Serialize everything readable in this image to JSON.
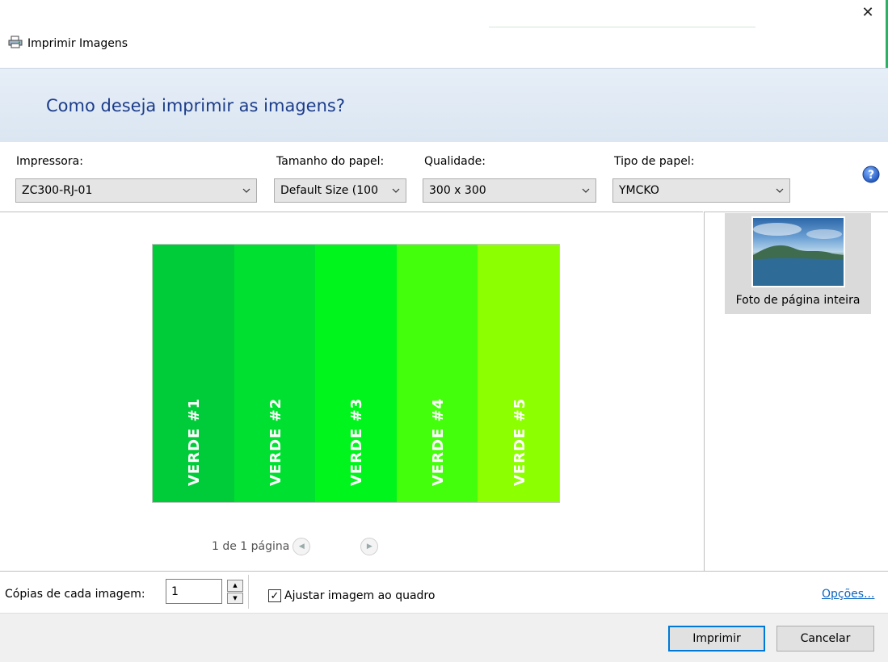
{
  "window": {
    "title": "Imprimir Imagens",
    "close_glyph": "✕",
    "icons": [
      "printer-icon",
      "close-icon"
    ]
  },
  "header": {
    "question": "Como deseja imprimir as imagens?"
  },
  "settings": {
    "printer": {
      "label": "Impressora:",
      "value": "ZC300-RJ-01"
    },
    "paper_size": {
      "label": "Tamanho do papel:",
      "value": "Default Size (100"
    },
    "quality": {
      "label": "Qualidade:",
      "value": "300 x 300"
    },
    "paper_type": {
      "label": "Tipo de papel:",
      "value": "YMCKO"
    },
    "help_icon": "help-icon",
    "help_glyph": "?"
  },
  "preview": {
    "stripes": [
      {
        "label": "VERDE #1",
        "color": "#00cc3a"
      },
      {
        "label": "VERDE #2",
        "color": "#00e031"
      },
      {
        "label": "VERDE #3",
        "color": "#00f51c"
      },
      {
        "label": "VERDE #4",
        "color": "#44ff0c"
      },
      {
        "label": "VERDE #5",
        "color": "#8cff00"
      }
    ],
    "pager_text": "1 de 1 página",
    "prev_glyph": "◀",
    "next_glyph": "▶"
  },
  "layouts": {
    "selected_label": "Foto de página inteira"
  },
  "copies": {
    "label": "Cópias de cada imagem:",
    "value": "1",
    "up_glyph": "▲",
    "down_glyph": "▼"
  },
  "fit_to_frame": {
    "label": "Ajustar imagem ao quadro",
    "checked": true,
    "check_glyph": "✓"
  },
  "options_link": "Opções...",
  "buttons": {
    "print": "Imprimir",
    "cancel": "Cancelar"
  },
  "colors": {
    "header_text": "#1b3c8a",
    "link": "#0a66c2",
    "primary_border": "#0078d7"
  }
}
